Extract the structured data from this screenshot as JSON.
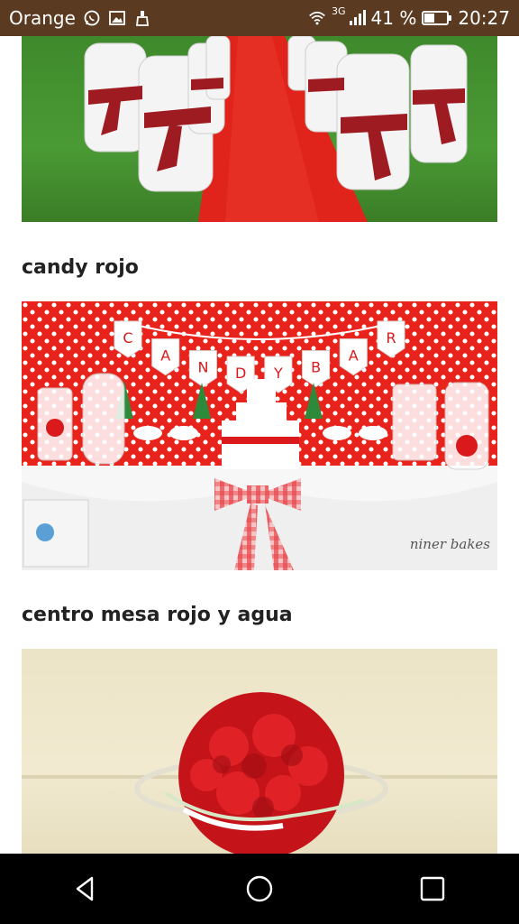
{
  "status_bar": {
    "carrier": "Orange",
    "network": "3G",
    "battery": "41 %",
    "time": "20:27"
  },
  "feed": {
    "items": [
      {
        "caption": "candy rojo"
      },
      {
        "caption": "centro mesa rojo y agua"
      }
    ],
    "watermark": "niner bakes"
  },
  "banner_letters": [
    "C",
    "A",
    "N",
    "D",
    "Y",
    "B",
    "A",
    "R"
  ],
  "icons": {
    "status_left": [
      "whatsapp-icon",
      "image-icon",
      "cleaner-icon"
    ],
    "status_right": [
      "wifi-icon",
      "signal-icon",
      "battery-icon"
    ],
    "nav": [
      "back-icon",
      "home-icon",
      "recents-icon"
    ]
  },
  "colors": {
    "status_bar": "#5a3b22",
    "nav_bar": "#000000",
    "accent_red": "#e8231c"
  }
}
